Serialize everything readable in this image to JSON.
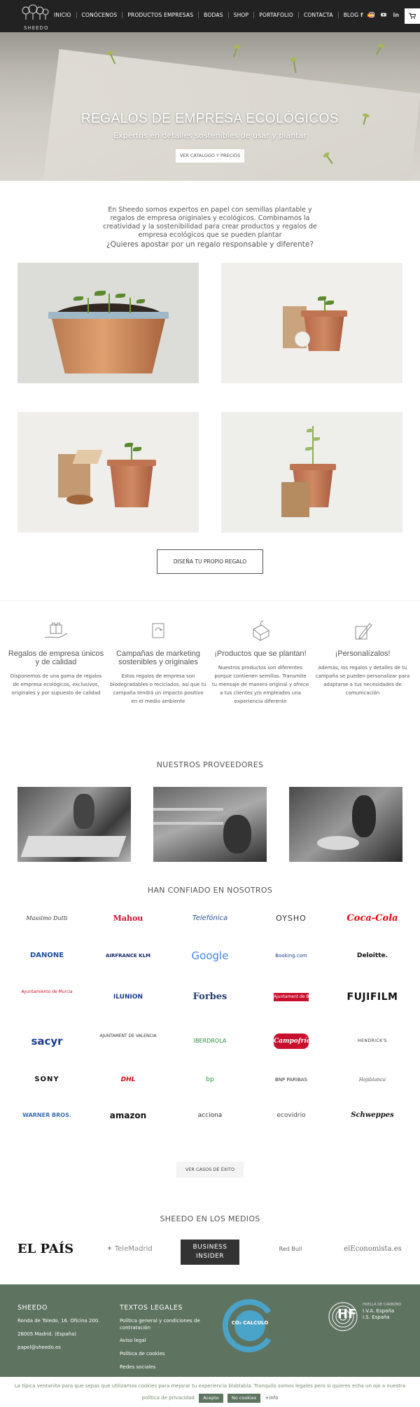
{
  "brand": {
    "logo_text": "SHEEDO"
  },
  "nav": {
    "items": [
      "INICIO",
      "CONÓCENOS",
      "PRODUCTOS EMPRESAS",
      "BODAS",
      "SHOP",
      "PORTAFOLIO",
      "CONTACTA",
      "BLOG"
    ],
    "social": [
      "f",
      "ig",
      "yt",
      "in"
    ],
    "cart_icon": "cart-icon"
  },
  "hero": {
    "title": "REGALOS DE EMPRESA ECOLÓGICOS",
    "subtitle": "Expertos en detalles sostenibles de usar y plantar",
    "button": "VER CATALOGO Y PRECIOS"
  },
  "intro": {
    "text": "En Sheedo somos expertos en papel con semillas plantable y regalos de empresa originales y ecológicos. Combinamos la creatividad y la sostenibilidad para crear productos y regalos de empresa ecológicos que se pueden plantar",
    "question": "¿Quieres apostar por un regalo responsable y diferente?"
  },
  "design_button": "DISEÑA TU PROPIO REGALO",
  "features": [
    {
      "title": "Regalos de empresa únicos y de calidad",
      "text": "Disponemos de una gama de regalos de empresa ecológicos, exclusivos, originales y por supuesto de calidad"
    },
    {
      "title": "Campañas de marketing sostenibles y originales",
      "text": "Estos regalos de empresa son biodegradables o reciclados, así que tu campaña tendrá un impacto positivo en el medio ambiente"
    },
    {
      "title": "¡Productos que se plantan!",
      "text": "Nuestros productos son diferentes porque contienen semillas. Transmite tu mensaje de manera original y ofrece a tus clientes y/o empleados una experiencia diferente"
    },
    {
      "title": "¡Personalízalos!",
      "text": "Además, los regalos y detalles de tu campaña se pueden personalizar para adaptarse a tus necesidades de comunicación"
    }
  ],
  "providers": {
    "title": "NUESTROS PROVEEDORES"
  },
  "clients": {
    "title": "HAN CONFIADO EN NOSOTROS",
    "logos": [
      "Massimo Dutti",
      "Mahou",
      "Telefónica",
      "OYSHO",
      "Coca-Cola",
      "DANONE",
      "AIRFRANCE KLM",
      "Google",
      "Booking.com",
      "Deloitte.",
      "Ayuntamiento de Murcia",
      "ILUNION",
      "Forbes",
      "Ajuntament de Barcelona",
      "FUJIFILM",
      "sacyr",
      "AJUNTAMENT DE VALÈNCIA",
      "IBERDROLA",
      "Campofrío",
      "HENDRICK'S",
      "SONY",
      "DHL",
      "bp",
      "BNP PARIBAS",
      "Hojiblanca",
      "WARNER BROS.",
      "amazon",
      "acciona",
      "ecovidrio",
      "Schweppes"
    ],
    "button": "VER CASOS DE ÉXITO"
  },
  "media": {
    "title": "SHEEDO EN LOS MEDIOS",
    "logos": [
      "EL PAÍS",
      "TeleMadrid",
      "BUSINESS INSIDER",
      "Red Bull",
      "elEconomista.es"
    ]
  },
  "footer": {
    "company_title": "SHEEDO",
    "address_1": "Ronda de Toledo, 16. Oficina 200.",
    "address_2": "28005 Madrid. (España)",
    "email": "papel@sheedo.es",
    "legal_title": "TEXTOS LEGALES",
    "legal_links": [
      "Política general y condiciones de contratación",
      "Aviso legal",
      "Política de cookies",
      "Redes sociales"
    ],
    "badge_text": "CO₂ CALCULO",
    "hf_text": "HF",
    "hf_caption": "HUELLA DE CARBONO",
    "hf_lines": [
      "I.V.A. España",
      "I.S. España"
    ]
  },
  "cookie": {
    "text": "La típica ventanita para que sepas que utilizamos cookies para mejorar tu experiencia blablabla. Tranquilo somos legales pero si quieres echa un ojo a nuestra política de privacidad",
    "accept": "Acepto",
    "reject": "No cookies",
    "info": "+info"
  },
  "colors": {
    "nav_bg": "#222222",
    "footer_bg": "#5e7360",
    "accent_red": "#c8102e"
  }
}
